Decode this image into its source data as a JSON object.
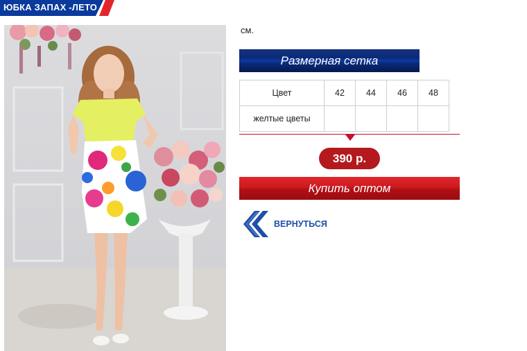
{
  "header": {
    "title": "ЮБКА ЗАПАХ -ЛЕТО"
  },
  "product": {
    "image_alt": "product photo",
    "unit_text": "см.",
    "size_chart_button": "Размерная сетка",
    "size_table": {
      "header_label": "Цвет",
      "sizes": [
        "42",
        "44",
        "46",
        "48"
      ],
      "rows": [
        {
          "color": "желтые цветы",
          "cells": [
            "",
            "",
            "",
            ""
          ]
        }
      ]
    },
    "price": "390 р.",
    "buy_button": "Купить оптом",
    "back_link": "ВЕРНУТЬСЯ"
  },
  "colors": {
    "brand_blue": "#0a2a78",
    "brand_red": "#c8102e",
    "price_bg": "#b41a1d",
    "link_blue": "#1f4fa8"
  }
}
